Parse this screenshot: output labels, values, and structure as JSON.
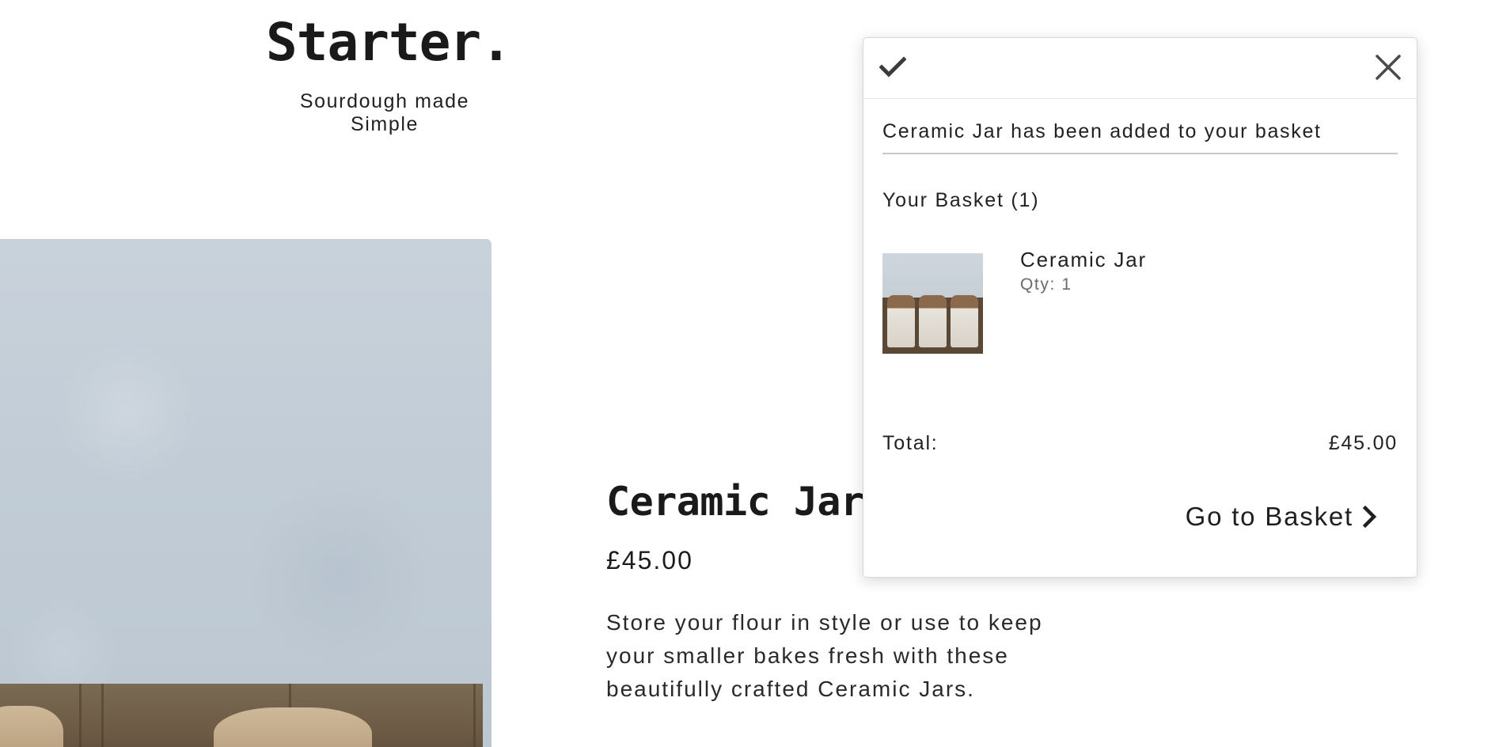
{
  "brand": {
    "logo": "Starter.",
    "tagline": "Sourdough made Simple"
  },
  "product": {
    "title": "Ceramic Jar",
    "price": "£45.00",
    "description": "Store your flour in style or use to keep your smaller bakes fresh with these beautifully crafted Ceramic Jars."
  },
  "basket_popup": {
    "status_icon": "check-icon",
    "close_icon": "close-icon",
    "added_message": "Ceramic Jar has been added to your basket",
    "heading": "Your Basket (1)",
    "items": [
      {
        "name": "Ceramic Jar",
        "qty": "Qty: 1",
        "thumbnail": "ceramic-jars-thumbnail"
      }
    ],
    "total_label": "Total:",
    "total_value": "£45.00",
    "cta_label": "Go to Basket",
    "cta_icon": "chevron-right-icon"
  },
  "colors": {
    "text": "#1c1c1c",
    "muted": "#6a6a6a",
    "image_wall": "#c4ced8",
    "shelf": "#6d5b45"
  }
}
